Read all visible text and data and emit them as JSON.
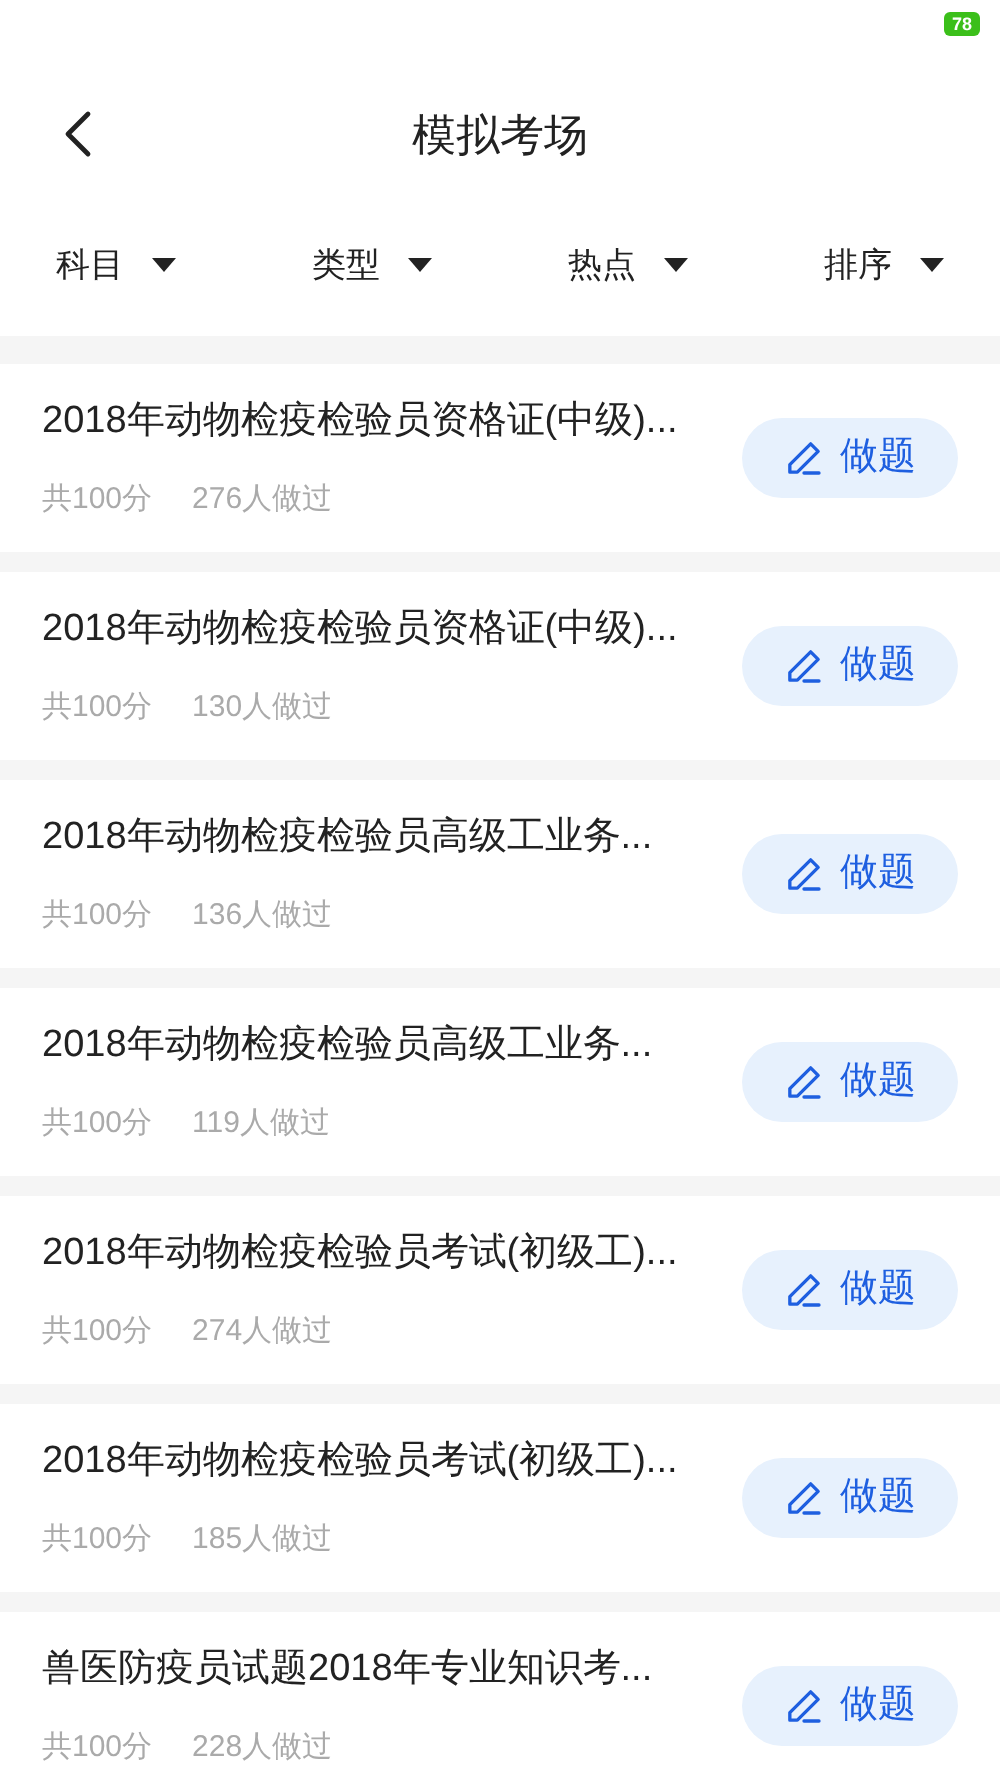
{
  "status_bar": {
    "battery": "78"
  },
  "header": {
    "title": "模拟考场"
  },
  "filters": [
    {
      "label": "科目"
    },
    {
      "label": "类型"
    },
    {
      "label": "热点"
    },
    {
      "label": "排序"
    }
  ],
  "exams": [
    {
      "title": "2018年动物检疫检验员资格证(中级)...",
      "score": "共100分",
      "count": "276人做过",
      "button": "做题"
    },
    {
      "title": "2018年动物检疫检验员资格证(中级)...",
      "score": "共100分",
      "count": "130人做过",
      "button": "做题"
    },
    {
      "title": "2018年动物检疫检验员高级工业务...",
      "score": "共100分",
      "count": "136人做过",
      "button": "做题"
    },
    {
      "title": "2018年动物检疫检验员高级工业务...",
      "score": "共100分",
      "count": "119人做过",
      "button": "做题"
    },
    {
      "title": "2018年动物检疫检验员考试(初级工)...",
      "score": "共100分",
      "count": "274人做过",
      "button": "做题"
    },
    {
      "title": "2018年动物检疫检验员考试(初级工)...",
      "score": "共100分",
      "count": "185人做过",
      "button": "做题"
    },
    {
      "title": "兽医防疫员试题2018年专业知识考...",
      "score": "共100分",
      "count": "228人做过",
      "button": "做题"
    }
  ]
}
